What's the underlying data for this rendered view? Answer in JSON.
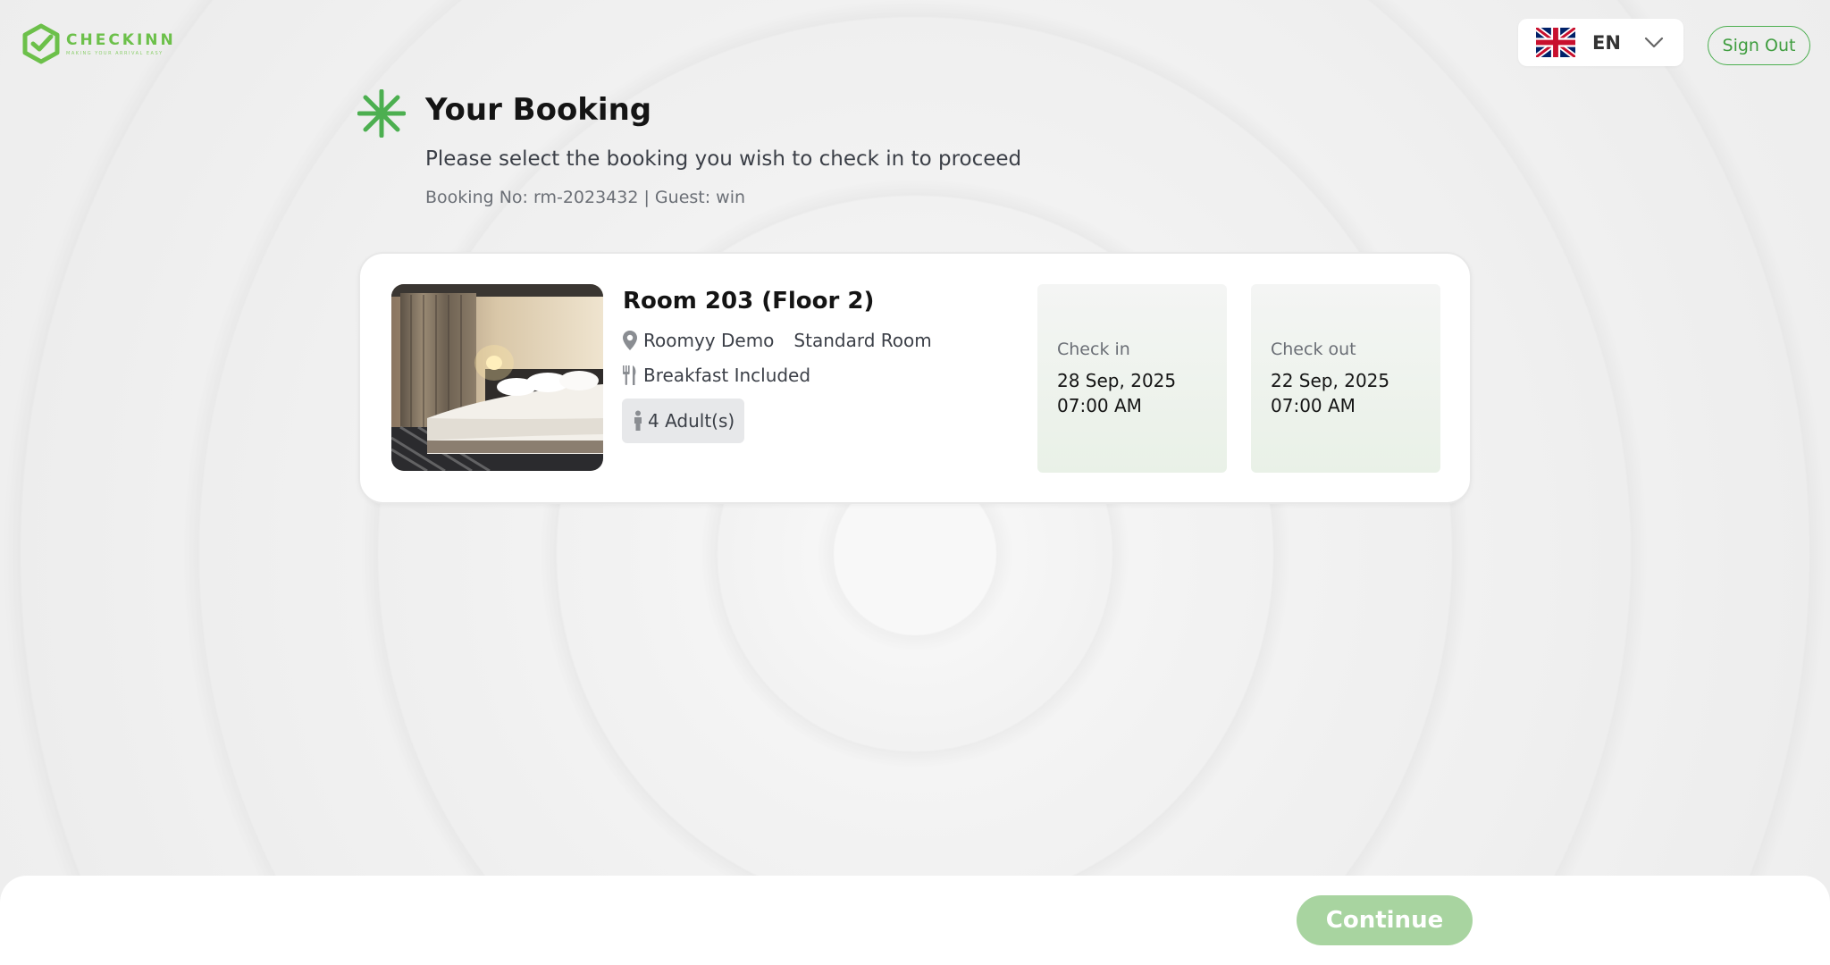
{
  "brand": {
    "name": "CHECKINN",
    "tagline": "MAKING YOUR ARRIVAL EASY",
    "accent": "#6cc04a"
  },
  "header": {
    "language": {
      "code": "EN",
      "flag": "uk-flag-icon"
    },
    "sign_out_label": "Sign Out"
  },
  "page": {
    "title": "Your Booking",
    "subtitle": "Please select the booking you wish to check in to proceed",
    "booking_info": "Booking No: rm-2023432 | Guest: win"
  },
  "booking": {
    "room": "Room 203 (Floor 2)",
    "property": "Roomyy Demo",
    "room_type": "Standard Room",
    "meal": "Breakfast Included",
    "guests": "4 Adult(s)",
    "check_in": {
      "label": "Check in",
      "date": "28 Sep, 2025",
      "time": "07:00 AM"
    },
    "check_out": {
      "label": "Check out",
      "date": "22 Sep, 2025",
      "time": "07:00 AM"
    }
  },
  "footer": {
    "continue_label": "Continue",
    "continue_color": "#a8d4a0"
  }
}
